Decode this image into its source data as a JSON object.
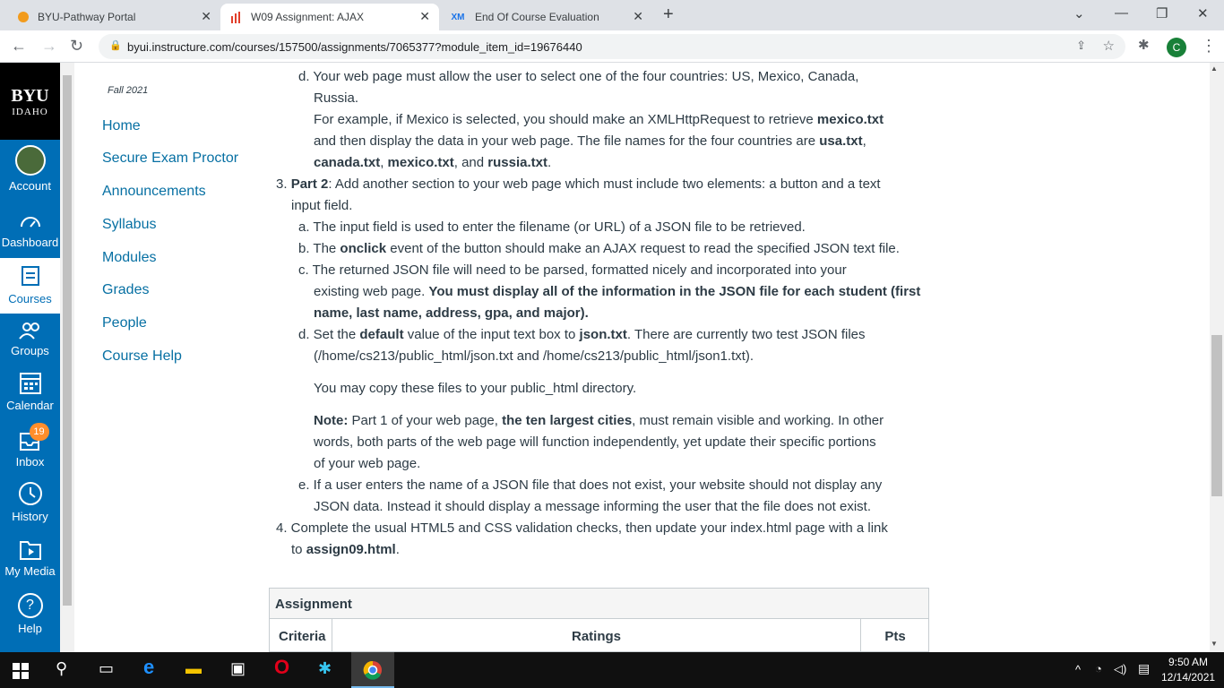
{
  "browser": {
    "tabs": [
      {
        "title": "BYU-Pathway Portal",
        "active": false
      },
      {
        "title": "W09 Assignment: AJAX",
        "active": true
      },
      {
        "title": "End Of Course Evaluation",
        "active": false
      }
    ],
    "url": "byui.instructure.com/courses/157500/assignments/7065377?module_item_id=19676440",
    "profile_initial": "C"
  },
  "global_nav": {
    "brand_top": "BYU",
    "brand_bottom": "IDAHO",
    "items": [
      {
        "label": "Account"
      },
      {
        "label": "Dashboard"
      },
      {
        "label": "Courses"
      },
      {
        "label": "Groups"
      },
      {
        "label": "Calendar"
      },
      {
        "label": "Inbox",
        "badge": "19"
      },
      {
        "label": "History"
      },
      {
        "label": "My Media"
      },
      {
        "label": "Help"
      }
    ]
  },
  "course_nav": {
    "term": "Fall 2021",
    "links": [
      "Home",
      "Secure Exam Proctor",
      "Announcements",
      "Syllabus",
      "Modules",
      "Grades",
      "People",
      "Course Help"
    ]
  },
  "content": {
    "d1_a": "d. Your web page must allow the user to select one of the four countries: US, Mexico, Canada,",
    "d1_b": "Russia.",
    "ex1_a": "For example, if Mexico is selected, you should make an XMLHttpRequest to retrieve ",
    "ex1_b": "mexico.txt",
    "ex2_a": "and then display the data in your web page. The file names for the four countries are ",
    "ex2_b": "usa.txt",
    "ex2_c": ",",
    "ex3_a": "canada.txt",
    "ex3_b": ", ",
    "ex3_c": "mexico.txt",
    "ex3_d": ", and ",
    "ex3_e": "russia.txt",
    "ex3_f": ".",
    "p2_num": "3. ",
    "p2_bold": "Part 2",
    "p2_rest": ": Add another section to your web page which must include two elements: a button and a text",
    "p2_b": "input field.",
    "a_line": "a. The input field is used to enter the filename (or URL) of a JSON file to be retrieved.",
    "b_a": "b. The ",
    "b_bold": "onclick",
    "b_rest": " event of the button should make an AJAX request to read the specified JSON text file.",
    "c_line1": "c. The returned JSON file will need to be parsed, formatted nicely and incorporated into your",
    "c_line2a": "existing web page. ",
    "c_line2b": "You must display all of the information in the JSON file for each student (first",
    "c_line3": "name, last name, address, gpa, and major).",
    "d2_a": "d. Set the ",
    "d2_bold1": "default",
    "d2_mid": " value of the input text box to ",
    "d2_bold2": "json.txt",
    "d2_rest": ". There are currently two test JSON files",
    "d2_line2": "(/home/cs213/public_html/json.txt and /home/cs213/public_html/json1.txt).",
    "copy": "You may copy these files to your public_html directory.",
    "note_bold": "Note:",
    "note_a": " Part 1 of your web page, ",
    "note_bold2": "the ten largest cities",
    "note_b": ", must remain visible and working. In other",
    "note_line2": "words, both parts of the web page will function independently, yet update their specific portions",
    "note_line3": "of your web page.",
    "e_line1": "e. If a user enters the name of a JSON file that does not exist, your website should not display any",
    "e_line2": "JSON data. Instead it should display a message informing the user that the file does not exist.",
    "s4_line1": "4. Complete the usual HTML5 and CSS validation checks, then update your index.html page with a link",
    "s4_a": "to ",
    "s4_bold": "assign09.html",
    "s4_b": "."
  },
  "rubric": {
    "title": "Assignment",
    "headers": [
      "Criteria",
      "Ratings",
      "Pts"
    ]
  },
  "taskbar": {
    "time": "9:50 AM",
    "date": "12/14/2021"
  }
}
